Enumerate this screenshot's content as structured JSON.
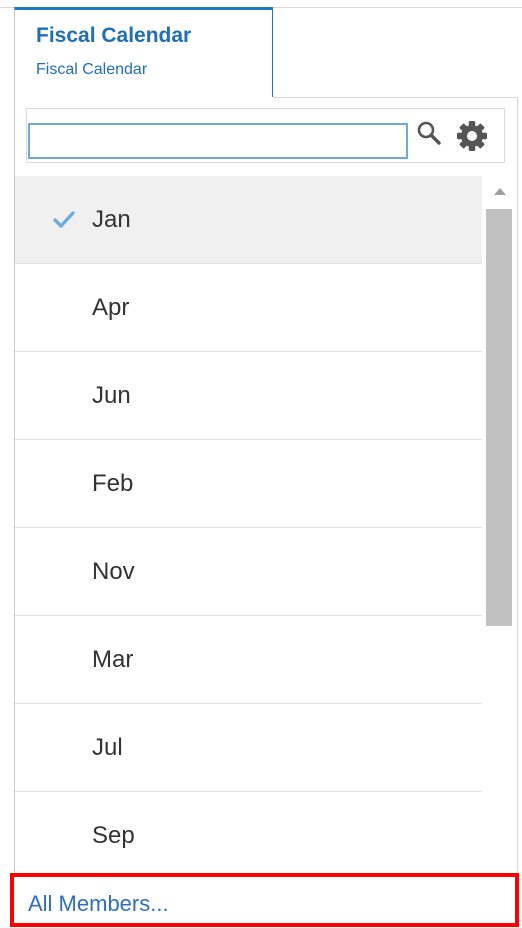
{
  "tab": {
    "title": "Fiscal Calendar",
    "subtitle": "Fiscal Calendar"
  },
  "search": {
    "value": "",
    "placeholder": "",
    "search_icon": "search-icon",
    "settings_icon": "gear-icon"
  },
  "members": [
    {
      "label": "Jan",
      "selected": true
    },
    {
      "label": "Apr",
      "selected": false
    },
    {
      "label": "Jun",
      "selected": false
    },
    {
      "label": "Feb",
      "selected": false
    },
    {
      "label": "Nov",
      "selected": false
    },
    {
      "label": "Mar",
      "selected": false
    },
    {
      "label": "Jul",
      "selected": false
    },
    {
      "label": "Sep",
      "selected": false
    }
  ],
  "footer": {
    "all_members_label": "All Members..."
  },
  "colors": {
    "accent": "#1f77c9",
    "link": "#2e6fbe",
    "check": "#6aaee0",
    "selected_row": "#f0f0f0",
    "highlight_border": "#ff0000",
    "scroll_thumb": "#c1c1c1"
  }
}
